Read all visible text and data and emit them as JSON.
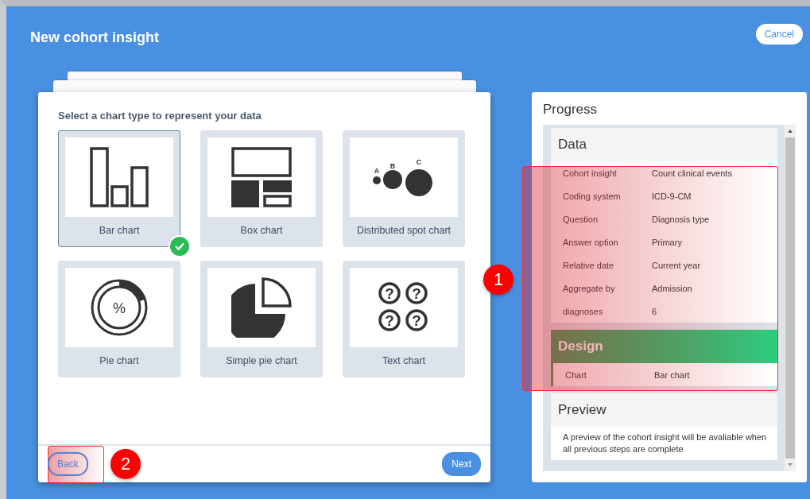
{
  "window": {
    "title": "New cohort insight"
  },
  "cancel_button": "Cancel",
  "chart_picker": {
    "prompt": "Select a chart type to represent your data",
    "options": [
      {
        "label": "Bar chart",
        "kind": "bar",
        "selected": true
      },
      {
        "label": "Box chart",
        "kind": "box",
        "selected": false
      },
      {
        "label": "Distributed spot chart",
        "kind": "spot",
        "selected": false,
        "icon_text": [
          "A",
          "B",
          "C"
        ]
      },
      {
        "label": "Pie chart",
        "kind": "pie",
        "selected": false,
        "icon_text": [
          "%"
        ]
      },
      {
        "label": "Simple pie chart",
        "kind": "simple-pie",
        "selected": false
      },
      {
        "label": "Text chart",
        "kind": "text",
        "selected": false,
        "icon_text": [
          "?",
          "?",
          "?",
          "?"
        ]
      }
    ]
  },
  "footer": {
    "back": "Back",
    "next": "Next"
  },
  "progress": {
    "title": "Progress",
    "sections": [
      {
        "title": "Data",
        "active": false,
        "rows": [
          {
            "label": "Cohort insight",
            "value": "Count clinical events"
          },
          {
            "label": "Coding system",
            "value": "ICD-9-CM"
          },
          {
            "label": "Question",
            "value": "Diagnosis type"
          },
          {
            "label": "Answer option",
            "value": "Primary"
          },
          {
            "label": "Relative date",
            "value": "Current year"
          },
          {
            "label": "Aggregate by",
            "value": "Admission"
          },
          {
            "label": "diagnoses",
            "value": "6"
          }
        ]
      },
      {
        "title": "Design",
        "active": true,
        "rows": [
          {
            "label": "Chart",
            "value": "Bar chart"
          }
        ]
      },
      {
        "title": "Preview",
        "active": false,
        "note": "A preview of the cohort insight will be avaliable when all previous steps are complete"
      }
    ]
  },
  "annotations": [
    {
      "number": "1"
    },
    {
      "number": "2"
    }
  ]
}
